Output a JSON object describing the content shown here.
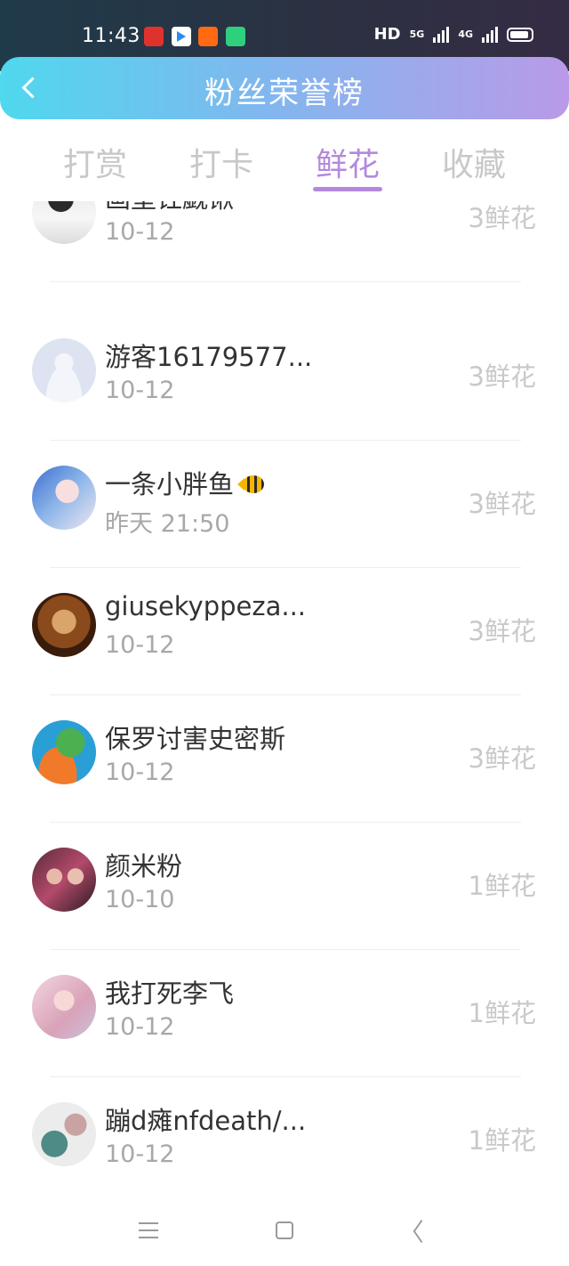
{
  "status_bar": {
    "time": "11:43",
    "app_icons": [
      "toutiao-app-icon",
      "youku-app-icon",
      "orange-app-icon",
      "green-app-icon"
    ],
    "network_label": "HD",
    "signal_label_1": "5G",
    "signal_label_2": "4G"
  },
  "header": {
    "title": "粉丝荣誉榜",
    "gradient_start": "#4fd8ee",
    "gradient_end": "#b99ae8"
  },
  "tabs": [
    {
      "label": "打赏",
      "active": false
    },
    {
      "label": "打卡",
      "active": false
    },
    {
      "label": "鲜花",
      "active": true
    },
    {
      "label": "收藏",
      "active": false
    }
  ],
  "accent_color": "#b489dd",
  "fans": [
    {
      "name": "画壁钍觑锹",
      "date": "10-12",
      "count": "3鲜花",
      "avatar": "dark-hair-photo"
    },
    {
      "name": "游客16179577...",
      "date": "10-12",
      "count": "3鲜花",
      "avatar": "default-guest"
    },
    {
      "name": "一条小胖鱼",
      "date": "昨天 21:50",
      "count": "3鲜花",
      "avatar": "girl-photo",
      "emoji": "fish-icon"
    },
    {
      "name": "giusekyppeza...",
      "date": "10-12",
      "count": "3鲜花",
      "avatar": "brown-emblem"
    },
    {
      "name": "保罗讨害史密斯",
      "date": "10-12",
      "count": "3鲜花",
      "avatar": "green-frog"
    },
    {
      "name": "颜米粉",
      "date": "10-10",
      "count": "1鲜花",
      "avatar": "group-photo"
    },
    {
      "name": "我打死李飞",
      "date": "10-12",
      "count": "1鲜花",
      "avatar": "pink-photo"
    },
    {
      "name": "蹦d瘫nfdeath/...",
      "date": "10-12",
      "count": "1鲜花",
      "avatar": "cartoon"
    }
  ],
  "nav": [
    "menu-icon",
    "home-icon",
    "back-icon"
  ]
}
